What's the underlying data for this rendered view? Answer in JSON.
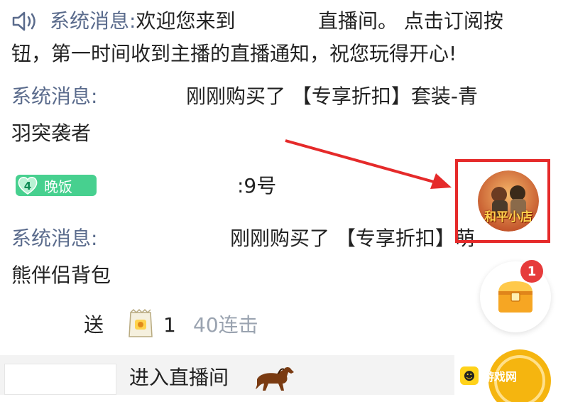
{
  "chat": {
    "welcome": {
      "label": "系统消息:",
      "text1": "欢迎您来到",
      "text2": "直播间。 点击订阅按",
      "text3": "钮，第一时间收到主播的直播通知，祝您玩得开心!"
    },
    "purchase1": {
      "label": "系统消息:",
      "text1": "刚刚购买了 【专享折扣】套装-青",
      "text2": "羽突袭者"
    },
    "badge_message": {
      "badge_level": "4",
      "badge_name": "晚饭",
      "text": ":9号"
    },
    "purchase2": {
      "label": "系统消息:",
      "text1": "刚刚购买了 【专享折扣】萌",
      "text2": "熊伴侣背包"
    },
    "gift": {
      "verb": "送",
      "count": "1",
      "combo": "40连击"
    },
    "entry": {
      "text": "进入直播间"
    }
  },
  "overlay": {
    "shop_icon_text": "和平小店",
    "chest_notification": "1",
    "watermark_text": "游戏网"
  },
  "icons": {
    "speaker": "speaker-icon",
    "badge_heart": "heart-badge-icon",
    "gift": "snack-bag-icon",
    "horse": "horse-icon",
    "chest": "treasure-chest-icon",
    "coin": "coin-icon"
  },
  "colors": {
    "system_label": "#5a6b8c",
    "badge_green": "#47d08f",
    "highlight_red": "#e52a2a",
    "notification_red": "#e63b3b",
    "muted_text": "#9aa3b0"
  }
}
